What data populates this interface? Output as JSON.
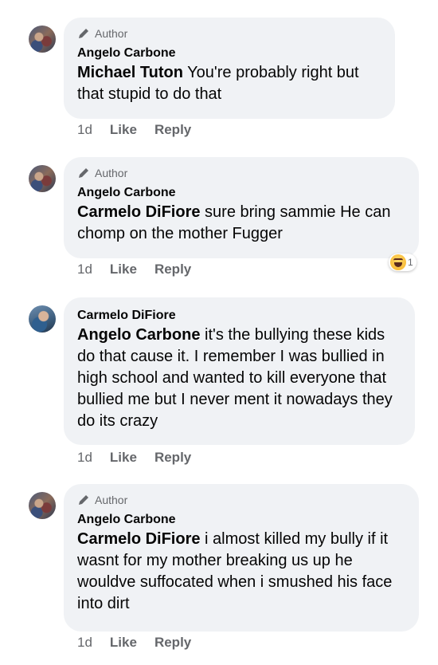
{
  "comments": [
    {
      "badge": "Author",
      "name": "Angelo Carbone",
      "tag": "Michael Tuton",
      "text": "  You're probably right but that stupid to do that",
      "time": "1d",
      "like": "Like",
      "reply": "Reply"
    },
    {
      "badge": "Author",
      "name": "Angelo Carbone",
      "tag": "Carmelo DiFiore",
      "text": " sure bring sammie  He can chomp on the mother Fugger",
      "time": "1d",
      "like": "Like",
      "reply": "Reply",
      "reaction": {
        "type": "haha",
        "count": "1"
      }
    },
    {
      "name": "Carmelo DiFiore",
      "tag": "Angelo Carbone",
      "text": " it's the bullying these kids do that cause it. I remember I was bullied in high school and wanted to kill everyone that bullied me but I never ment it nowadays they do its crazy",
      "time": "1d",
      "like": "Like",
      "reply": "Reply"
    },
    {
      "badge": "Author",
      "name": "Angelo Carbone",
      "tag": "Carmelo DiFiore",
      "text": " i almost killed my bully if it wasnt for my mother breaking us up he wouldve suffocated when i smushed his face into dirt",
      "time": "1d",
      "like": "Like",
      "reply": "Reply"
    }
  ],
  "colors": {
    "bubble": "#f0f2f5",
    "muted": "#65676b",
    "text": "#050505"
  }
}
